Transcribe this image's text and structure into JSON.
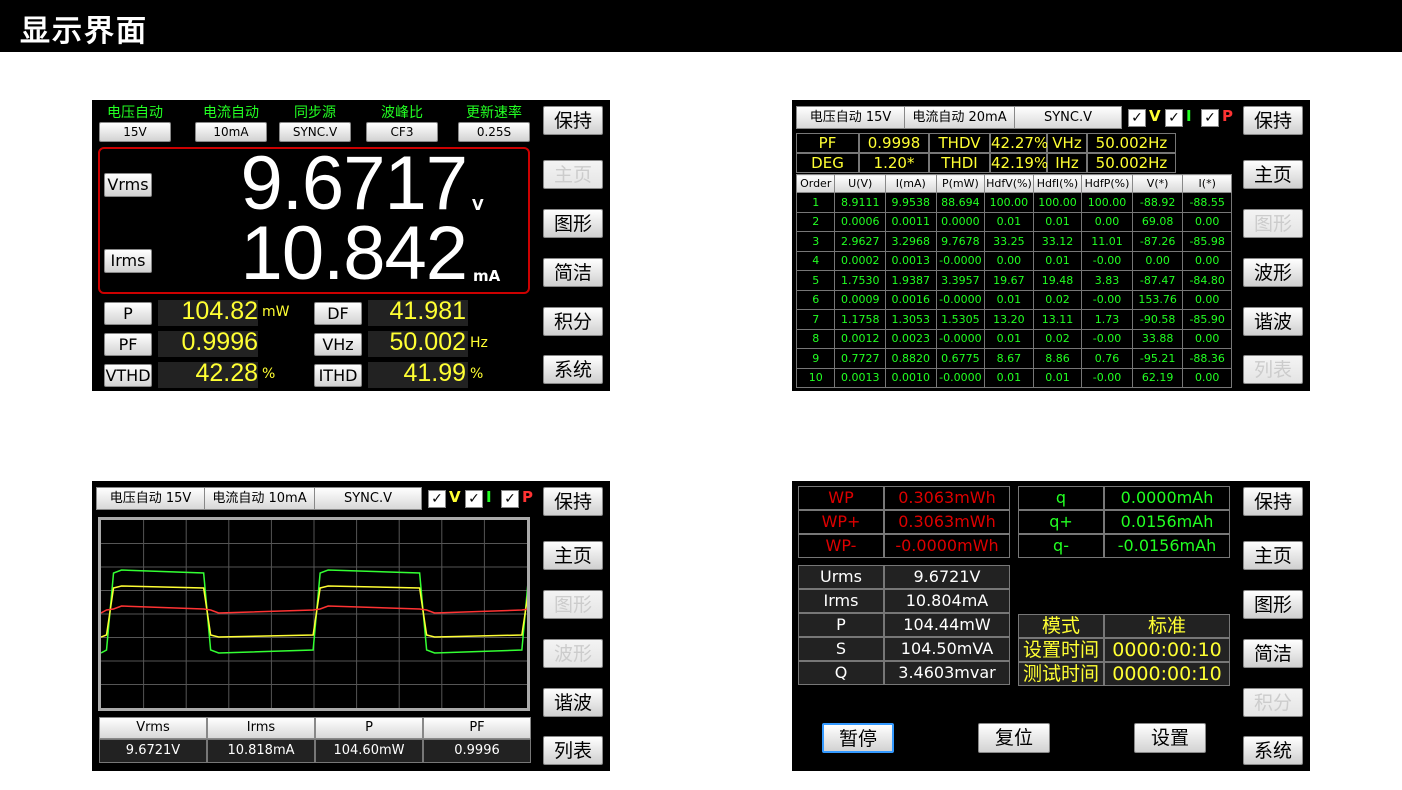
{
  "title": "显示界面",
  "s1": {
    "top_labels": [
      "电压自动",
      "电流自动",
      "同步源",
      "波峰比",
      "更新速率"
    ],
    "top_values": [
      "15V",
      "10mA",
      "SYNC.V",
      "CF3",
      "0.25S"
    ],
    "vrms_label": "Vrms",
    "irms_label": "Irms",
    "voltage": "9.6717",
    "voltage_unit": "V",
    "current": "10.842",
    "current_unit": "mA",
    "rows": [
      {
        "l1": "P",
        "v1": "104.82",
        "u1": "mW",
        "l2": "DF",
        "v2": "41.981",
        "u2": ""
      },
      {
        "l1": "PF",
        "v1": "0.9996",
        "u1": "",
        "l2": "VHz",
        "v2": "50.002",
        "u2": "Hz"
      },
      {
        "l1": "VTHD",
        "v1": "42.28",
        "u1": "%",
        "l2": "ITHD",
        "v2": "41.99",
        "u2": "%"
      }
    ],
    "side": [
      {
        "label": "保持",
        "enabled": true
      },
      {
        "label": "主页",
        "enabled": false
      },
      {
        "label": "图形",
        "enabled": true
      },
      {
        "label": "简洁",
        "enabled": true
      },
      {
        "label": "积分",
        "enabled": true
      },
      {
        "label": "系统",
        "enabled": true
      }
    ]
  },
  "s2": {
    "topbar": {
      "v": "电压自动 15V",
      "i": "电流自动 20mA",
      "sync": "SYNC.V",
      "chk_v": "V",
      "chk_i": "I",
      "chk_p": "P"
    },
    "summary": [
      [
        "PF",
        "0.9998",
        "THDV",
        "42.27%",
        "VHz",
        "50.002Hz"
      ],
      [
        "DEG",
        "1.20*",
        "THDI",
        "42.19%",
        "IHz",
        "50.002Hz"
      ]
    ],
    "headers": [
      "Order",
      "U(V)",
      "I(mA)",
      "P(mW)",
      "HdfV(%)",
      "HdfI(%)",
      "HdfP(%)",
      "V(*)",
      "I(*)"
    ],
    "rows": [
      [
        "1",
        "8.9111",
        "9.9538",
        "88.694",
        "100.00",
        "100.00",
        "100.00",
        "-88.92",
        "-88.55"
      ],
      [
        "2",
        "0.0006",
        "0.0011",
        "0.0000",
        "0.01",
        "0.01",
        "0.00",
        "69.08",
        "0.00"
      ],
      [
        "3",
        "2.9627",
        "3.2968",
        "9.7678",
        "33.25",
        "33.12",
        "11.01",
        "-87.26",
        "-85.98"
      ],
      [
        "4",
        "0.0002",
        "0.0013",
        "-0.0000",
        "0.00",
        "0.01",
        "-0.00",
        "0.00",
        "0.00"
      ],
      [
        "5",
        "1.7530",
        "1.9387",
        "3.3957",
        "19.67",
        "19.48",
        "3.83",
        "-87.47",
        "-84.80"
      ],
      [
        "6",
        "0.0009",
        "0.0016",
        "-0.0000",
        "0.01",
        "0.02",
        "-0.00",
        "153.76",
        "0.00"
      ],
      [
        "7",
        "1.1758",
        "1.3053",
        "1.5305",
        "13.20",
        "13.11",
        "1.73",
        "-90.58",
        "-85.90"
      ],
      [
        "8",
        "0.0012",
        "0.0023",
        "-0.0000",
        "0.01",
        "0.02",
        "-0.00",
        "33.88",
        "0.00"
      ],
      [
        "9",
        "0.7727",
        "0.8820",
        "0.6775",
        "8.67",
        "8.86",
        "0.76",
        "-95.21",
        "-88.36"
      ],
      [
        "10",
        "0.0013",
        "0.0010",
        "-0.0000",
        "0.01",
        "0.01",
        "-0.00",
        "62.19",
        "0.00"
      ]
    ],
    "side": [
      {
        "label": "保持",
        "enabled": true
      },
      {
        "label": "主页",
        "enabled": true
      },
      {
        "label": "图形",
        "enabled": false
      },
      {
        "label": "波形",
        "enabled": true
      },
      {
        "label": "谐波",
        "enabled": true
      },
      {
        "label": "列表",
        "enabled": false
      }
    ]
  },
  "s3": {
    "topbar": {
      "v": "电压自动 15V",
      "i": "电流自动 10mA",
      "sync": "SYNC.V",
      "chk_v": "V",
      "chk_i": "I",
      "chk_p": "P"
    },
    "bottom_headers": [
      "Vrms",
      "Irms",
      "P",
      "PF"
    ],
    "bottom_values": [
      "9.6721V",
      "10.818mA",
      "104.60mW",
      "0.9996"
    ],
    "wave_colors": {
      "voltage": "#ffff33",
      "current": "#33ff33",
      "power": "#ff3333"
    },
    "side": [
      {
        "label": "保持",
        "enabled": true
      },
      {
        "label": "主页",
        "enabled": true
      },
      {
        "label": "图形",
        "enabled": false
      },
      {
        "label": "波形",
        "enabled": false
      },
      {
        "label": "谐波",
        "enabled": true
      },
      {
        "label": "列表",
        "enabled": true
      }
    ]
  },
  "s4": {
    "wp": [
      [
        "WP",
        "0.3063mWh"
      ],
      [
        "WP+",
        "0.3063mWh"
      ],
      [
        "WP-",
        "-0.0000mWh"
      ]
    ],
    "q": [
      [
        "q",
        "0.0000mAh"
      ],
      [
        "q+",
        "0.0156mAh"
      ],
      [
        "q-",
        "-0.0156mAh"
      ]
    ],
    "meas": [
      [
        "Urms",
        "9.6721V"
      ],
      [
        "Irms",
        "10.804mA"
      ],
      [
        "P",
        "104.44mW"
      ],
      [
        "S",
        "104.50mVA"
      ],
      [
        "Q",
        "3.4603mvar"
      ]
    ],
    "mode": [
      [
        "模式",
        "标准"
      ],
      [
        "设置时间",
        "0000:00:10"
      ],
      [
        "测试时间",
        "0000:00:10"
      ]
    ],
    "buttons": [
      "暂停",
      "复位",
      "设置"
    ],
    "side": [
      {
        "label": "保持",
        "enabled": true
      },
      {
        "label": "主页",
        "enabled": true
      },
      {
        "label": "图形",
        "enabled": true
      },
      {
        "label": "简洁",
        "enabled": true
      },
      {
        "label": "积分",
        "enabled": false
      },
      {
        "label": "系统",
        "enabled": true
      }
    ]
  }
}
